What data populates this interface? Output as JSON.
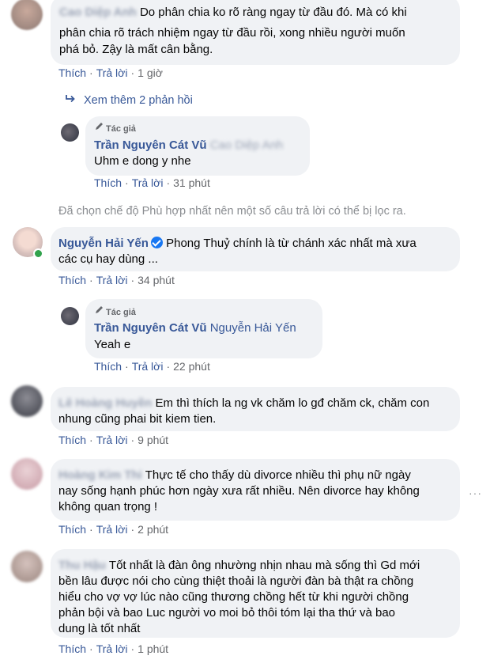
{
  "actions": {
    "like": "Thích",
    "reply": "Trả lời",
    "sep": "·"
  },
  "comment1": {
    "name": "Cao Diệp Anh",
    "lines": [
      "Do phân chia ko rõ ràng ngay từ đầu đó. Mà có khi",
      "phân chia rõ trách nhiệm ngay từ đầu rồi, xong nhiều người muốn",
      "phá bỏ. Zậy là mất cân bằng."
    ],
    "time": "1 giờ"
  },
  "see_more": "Xem thêm 2 phản hồi",
  "reply1": {
    "badge": "Tác giả",
    "name": "Trần Nguyên Cát Vũ",
    "tag": "Cao Diệp Anh",
    "text": "Uhm e dong y nhe",
    "time": "31 phút"
  },
  "filter_note": "Đã chọn chế độ Phù hợp nhất nên một số câu trả lời có thể bị lọc ra.",
  "comment2": {
    "name": "Nguyễn Hải Yến",
    "lines": [
      "Phong Thuỷ chính là từ chánh xác nhất mà xưa",
      "các cụ hay dùng ..."
    ],
    "time": "34 phút"
  },
  "reply2": {
    "badge": "Tác giả",
    "name": "Trần Nguyên Cát Vũ",
    "tag": "Nguyễn Hải Yến",
    "text": "Yeah e",
    "time": "22 phút"
  },
  "comment3": {
    "name": "Lê Hoàng Huyền",
    "lines": [
      "Em thì thích la ng vk chăm lo gđ chăm ck, chăm con",
      "nhung cũng phai bit kiem tien."
    ],
    "time": "9 phút"
  },
  "comment4": {
    "name": "Hoàng Kim Thi",
    "lines": [
      "Thực tế cho thấy dù divorce nhiều thì phụ nữ ngày",
      "nay sống hạnh phúc hơn ngày xưa rất nhiều. Nên divorce hay không",
      "không quan trọng !"
    ],
    "time": "2 phút"
  },
  "comment5": {
    "name": "Thu Hậu",
    "lines": [
      "Tốt nhất là đàn ông nhường nhịn nhau mà sống thì Gd mới",
      "bền lâu được nói cho cùng thiệt thoải là người đàn bà thật ra chồng",
      "hiểu cho vợ vợ lúc nào cũng thương chồng hết từ khi người chồng",
      "phản bội và bao Luc người vo moi bỏ thôi tóm lại tha thứ và bao",
      "dung là tốt nhất"
    ],
    "time": "1 phút"
  },
  "more_options": "···",
  "colors": {
    "bubble": "#f0f2f5",
    "link": "#385898",
    "meta": "#65676b",
    "verified": "#1877f2",
    "online": "#31a24c"
  }
}
